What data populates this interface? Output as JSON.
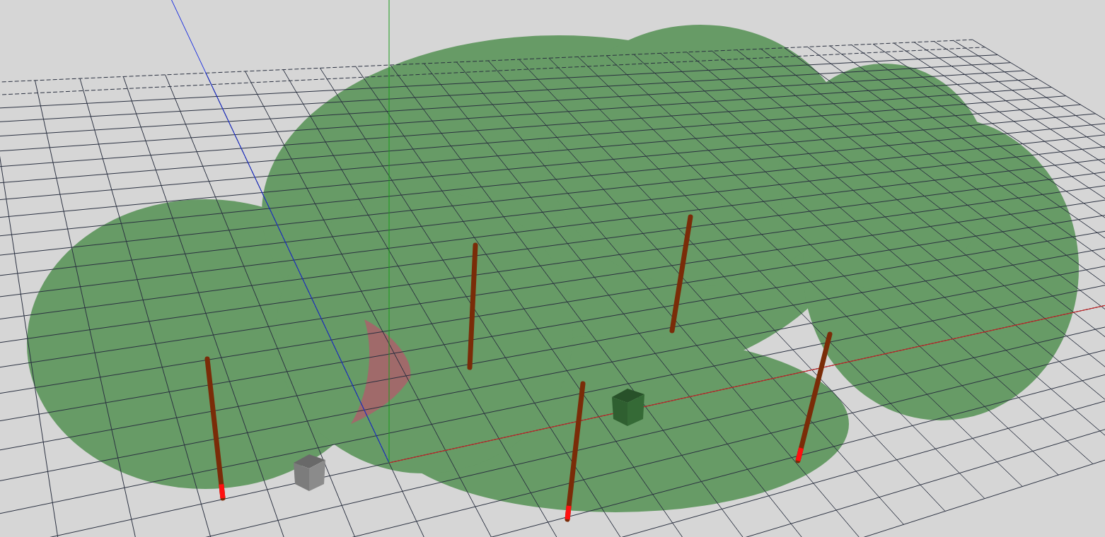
{
  "scene": {
    "poles": [
      {
        "base_marker": true
      },
      {
        "base_marker": false
      },
      {
        "base_marker": false
      },
      {
        "base_marker": true
      },
      {
        "base_marker": true
      }
    ],
    "cubes": [
      {
        "color": "#7c7c7c"
      },
      {
        "color": "#2f5f30"
      }
    ]
  }
}
